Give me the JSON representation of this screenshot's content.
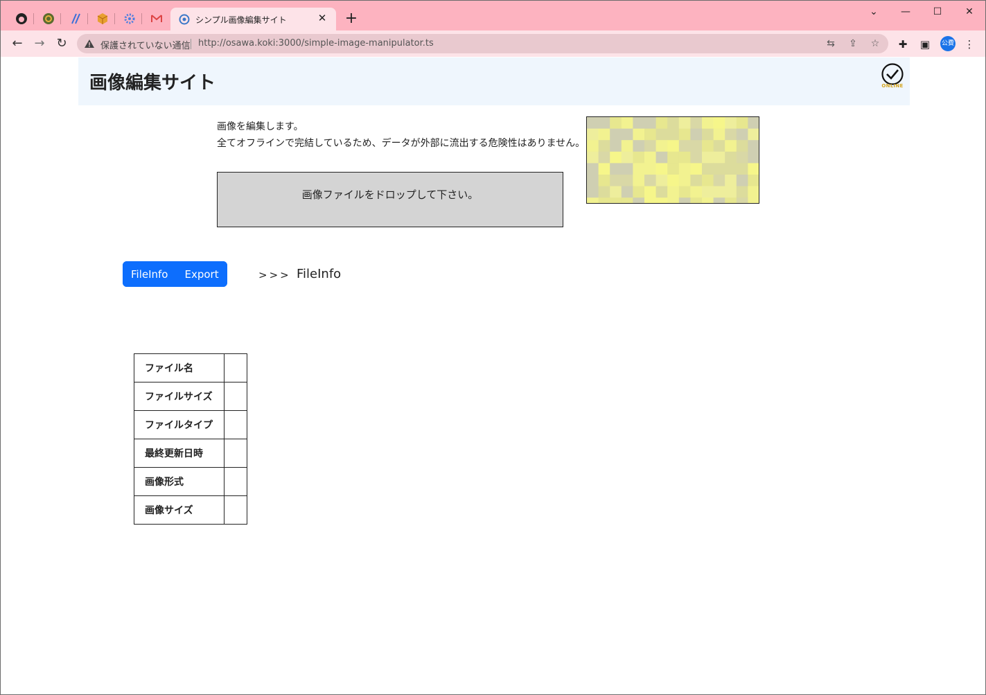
{
  "browser": {
    "active_tab_title": "シンプル画像編集サイト",
    "new_tab_label": "+",
    "security_status": "保護されていない通信",
    "url": "http://osawa.koki:3000/simple-image-manipulator.ts",
    "profile_label": "公費",
    "pinned_tabs": [
      "github-icon",
      "circle-q-icon",
      "slash-app-icon",
      "package-icon",
      "gear-icon",
      "gmail-icon"
    ],
    "accent_color": "#fdb3c0"
  },
  "header": {
    "title": "画像編集サイト",
    "status_badge": "ONLINE"
  },
  "description": {
    "line1": "画像を編集します。",
    "line2": "全てオフラインで完結しているため、データが外部に流出する危険性はありません。"
  },
  "dropzone": {
    "label": "画像ファイルをドロップして下さい。"
  },
  "menu": {
    "fileinfo_label": "FileInfo",
    "export_label": "Export",
    "button_color": "#0d6efd"
  },
  "section": {
    "arrow": ">>>",
    "current": "FileInfo"
  },
  "fileinfo_table": [
    {
      "key": "ファイル名",
      "value": ""
    },
    {
      "key": "ファイルサイズ",
      "value": ""
    },
    {
      "key": "ファイルタイプ",
      "value": ""
    },
    {
      "key": "最終更新日時",
      "value": ""
    },
    {
      "key": "画像形式",
      "value": ""
    },
    {
      "key": "画像サイズ",
      "value": ""
    }
  ]
}
